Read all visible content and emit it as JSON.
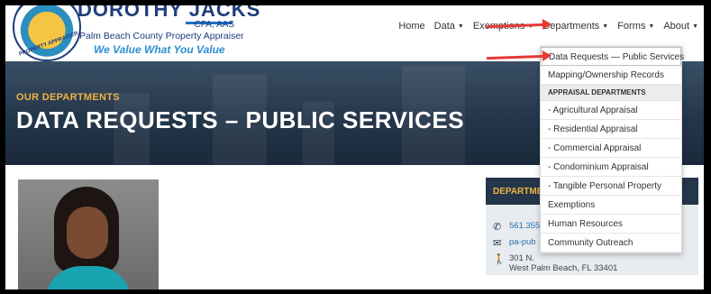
{
  "brand": {
    "name": "DOROTHY JACKS",
    "credentials": "CFA, AAS",
    "subtitle": "Palm Beach County Property Appraiser",
    "tagline": "We Value What You Value",
    "seal_text": "PROPERTY APPRAISER"
  },
  "nav": {
    "items": [
      {
        "label": "Home",
        "caret": false
      },
      {
        "label": "Data",
        "caret": true
      },
      {
        "label": "Exemptions",
        "caret": true
      },
      {
        "label": "Departments",
        "caret": true
      },
      {
        "label": "Forms",
        "caret": true
      },
      {
        "label": "About",
        "caret": true
      }
    ]
  },
  "hero": {
    "eyebrow": "OUR DEPARTMENTS",
    "title": "DATA REQUESTS – PUBLIC SERVICES"
  },
  "dropdown": {
    "items": [
      {
        "label": "Data Requests — Public Services",
        "type": "item"
      },
      {
        "label": "Mapping/Ownership Records",
        "type": "item"
      },
      {
        "label": "APPRAISAL DEPARTMENTS",
        "type": "header"
      },
      {
        "label": "- Agricultural Appraisal",
        "type": "item"
      },
      {
        "label": "- Residential Appraisal",
        "type": "item"
      },
      {
        "label": "- Commercial Appraisal",
        "type": "item"
      },
      {
        "label": "- Condominium Appraisal",
        "type": "item"
      },
      {
        "label": "- Tangible Personal Property",
        "type": "item"
      },
      {
        "label": "Exemptions",
        "type": "item"
      },
      {
        "label": "Human Resources",
        "type": "item"
      },
      {
        "label": "Community Outreach",
        "type": "item"
      }
    ]
  },
  "info": {
    "header": "DEPARTMENT",
    "phone": "561.355",
    "email": "pa-pub",
    "address_line1": "301 N.",
    "address_line2": "West Palm Beach, FL 33401"
  },
  "icons": {
    "phone": "phone-icon",
    "email": "envelope-icon",
    "address": "walking-person-icon"
  },
  "colors": {
    "navy": "#1e3d7a",
    "accent_gold": "#f0b340",
    "hero_bg": "#24364a",
    "arrow_red": "#e53935"
  }
}
